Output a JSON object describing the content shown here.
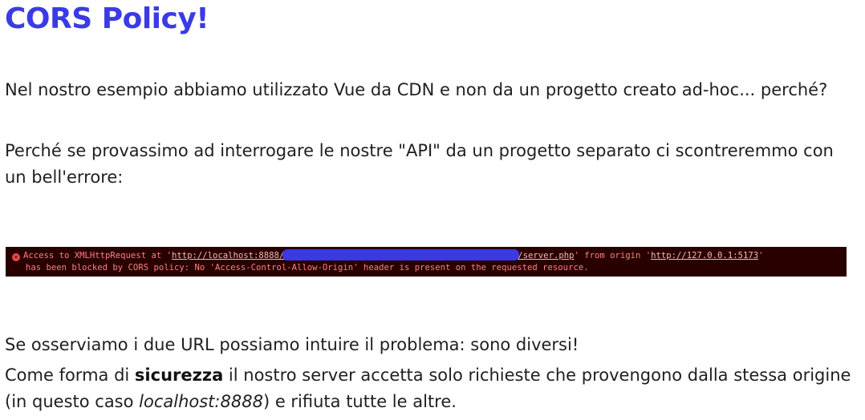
{
  "slide": {
    "title": "CORS Policy!",
    "p1": "Nel nostro esempio abbiamo utilizzato Vue da CDN e non da un progetto creato ad-hoc... perché?",
    "p2": "Perché se provassimo ad interrogare le nostre \"API\" da un progetto separato ci scontreremmo con un bell'errore:",
    "p3": "Se osserviamo i due URL possiamo intuire il problema: sono diversi!",
    "p4": {
      "before": "Come forma di ",
      "bold": "sicurezza",
      "middle": " il nostro server accetta solo richieste che provengono dalla stessa origine (in questo caso ",
      "italic": "localhost:8888",
      "after": ") e rifiuta tutte le altre."
    }
  },
  "console": {
    "icon": "error-icon",
    "prefix": "Access to XMLHttpRequest at '",
    "url1_start": "http://localhost:8888/",
    "url1_end": "/server.php",
    "middle": "' from origin '",
    "url2": "http://127.0.0.1:5173",
    "suffix": "'",
    "line2": "has been blocked by CORS policy: No 'Access-Control-Allow-Origin' header is present on the requested resource.",
    "colors": {
      "background": "#290000",
      "text": "#ff8080",
      "redaction": "#3a3ae0"
    }
  },
  "colors": {
    "title": "#3b3be6",
    "text": "#1f1f1f"
  }
}
